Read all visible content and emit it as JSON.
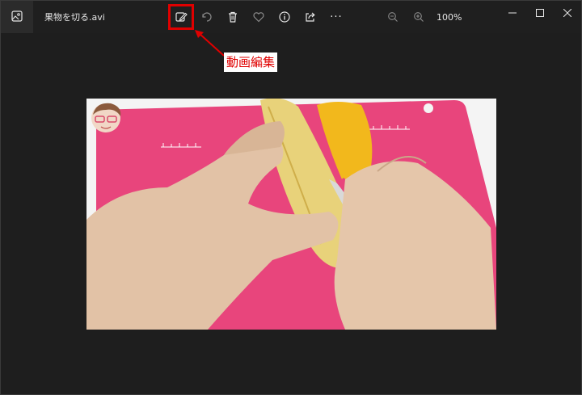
{
  "window": {
    "title": "果物を切る.avi"
  },
  "toolbar": {
    "zoom_level": "100%",
    "more_label": "···"
  },
  "annotation": {
    "label": "動画編集",
    "color": "#e00000"
  },
  "icons": {
    "app": "image-icon",
    "edit": "edit-video-icon",
    "rotate": "rotate-icon",
    "delete": "trash-icon",
    "favorite": "heart-icon",
    "info": "info-icon",
    "share": "share-icon",
    "more": "more-icon",
    "zoom_out": "zoom-out-icon",
    "zoom_in": "zoom-in-icon",
    "minimize": "minimize-icon",
    "maximize": "maximize-icon",
    "close": "close-icon"
  },
  "colors": {
    "background": "#1e1e1e",
    "cutting_board": "#e8457c",
    "highlight": "#e00000"
  }
}
